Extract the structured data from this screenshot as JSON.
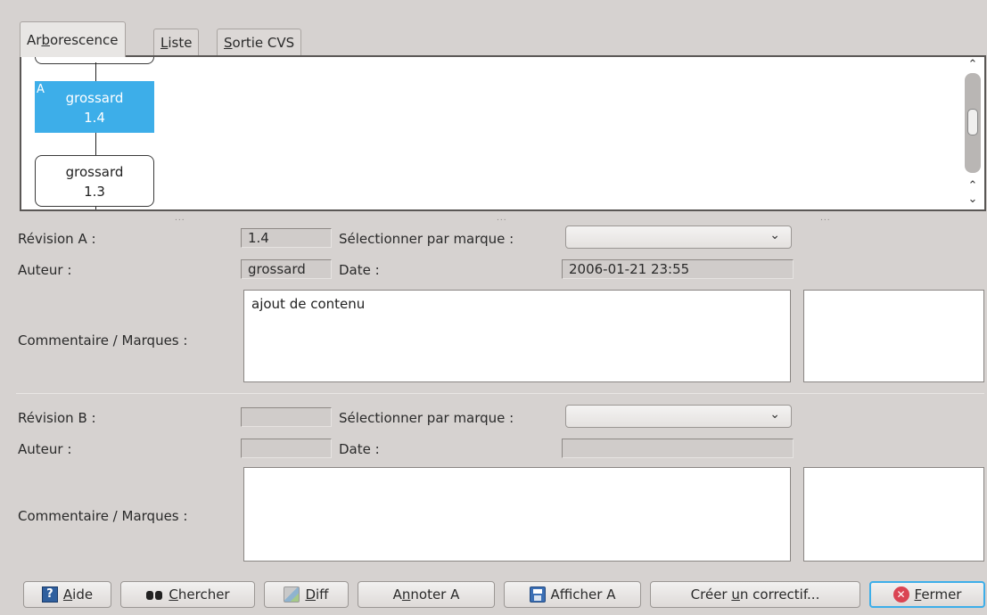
{
  "tabs": [
    {
      "pre": "Ar",
      "u": "b",
      "post": "orescence"
    },
    {
      "pre": "",
      "u": "L",
      "post": "iste"
    },
    {
      "pre": "",
      "u": "S",
      "post": "ortie CVS"
    }
  ],
  "tree": {
    "nodes": [
      {
        "author": "grossard",
        "revision": "1.4",
        "marker": "A"
      },
      {
        "author": "grossard",
        "revision": "1.3"
      }
    ],
    "splitter_dots": "..."
  },
  "revision_a": {
    "label": "Révision A :",
    "value": "1.4",
    "select_tag_label": "Sélectionner par marque :",
    "author_label": "Auteur :",
    "author": "grossard",
    "date_label": "Date :",
    "date": "2006-01-21 23:55",
    "comment_label": "Commentaire / Marques :",
    "comment": "ajout de contenu",
    "tags": ""
  },
  "revision_b": {
    "label": "Révision B :",
    "value": "",
    "select_tag_label": "Sélectionner par marque :",
    "author_label": "Auteur :",
    "author": "",
    "date_label": "Date :",
    "date": "",
    "comment_label": "Commentaire / Marques :",
    "comment": "",
    "tags": ""
  },
  "buttons": {
    "help": {
      "pre": "",
      "u": "A",
      "post": "ide",
      "icon": "help-icon"
    },
    "search": {
      "pre": "",
      "u": "C",
      "post": "hercher",
      "icon": "binoculars-icon"
    },
    "diff": {
      "pre": "",
      "u": "D",
      "post": "iff",
      "icon": "diff-icon"
    },
    "annotate": {
      "pre": "A",
      "u": "n",
      "post": "noter A"
    },
    "view": {
      "pre": "Af",
      "u": "f",
      "post": "icher A",
      "icon": "save-icon"
    },
    "patch": {
      "pre": "Créer ",
      "u": "u",
      "post": "n correctif..."
    },
    "close": {
      "pre": "",
      "u": "F",
      "post": "ermer",
      "icon": "close-icon"
    }
  },
  "colors": {
    "accent": "#3daee9",
    "background": "#d6d2d0",
    "close_icon": "#da4453"
  }
}
